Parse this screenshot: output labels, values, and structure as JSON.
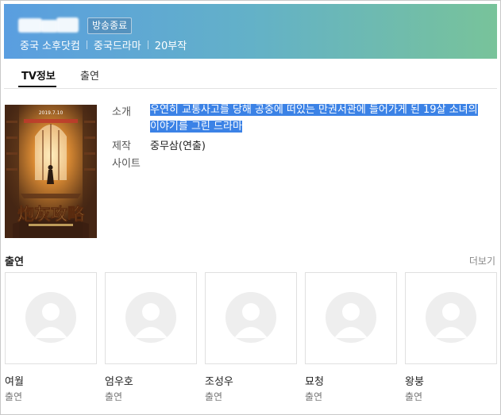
{
  "header": {
    "status_badge": "방송종료",
    "meta": [
      "중국 소후닷컴",
      "중국드라마",
      "20부작"
    ],
    "colors": {
      "gradient_start": "#5a9ee0",
      "gradient_end": "#78c39a"
    }
  },
  "tabs": [
    {
      "label": "TV정보",
      "active": true
    },
    {
      "label": "출연",
      "active": false
    }
  ],
  "info": {
    "intro_label": "소개",
    "intro_lines": [
      "우연히 교통사고를 당해 공중에 떠있는 만권서관에 들어가게 된 19살 소녀의",
      "이야기를 그린 드라마"
    ],
    "production_label": "제작",
    "production_name": "중무삼",
    "production_role": "(연출)",
    "site_label": "사이트"
  },
  "poster": {
    "date_text": "2019.7.10",
    "title_text": "炮灰攻略"
  },
  "cast": {
    "title": "출연",
    "more": "더보기",
    "members": [
      {
        "name": "여월",
        "role": "출연"
      },
      {
        "name": "엄우호",
        "role": "출연"
      },
      {
        "name": "조성우",
        "role": "출연"
      },
      {
        "name": "묘청",
        "role": "출연"
      },
      {
        "name": "왕붕",
        "role": "출연"
      }
    ]
  },
  "selection_color": "#3b82e6"
}
